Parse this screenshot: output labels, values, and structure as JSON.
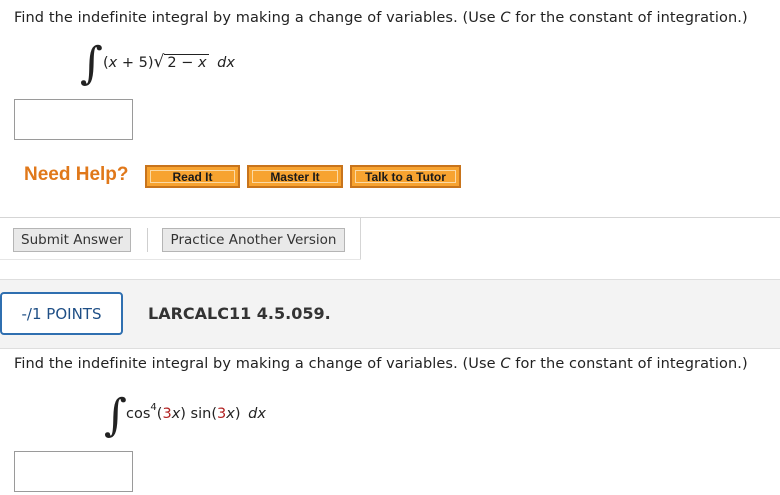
{
  "q1": {
    "prompt": "Find the indefinite integral by making a change of variables. (Use C for the constant of integration.)",
    "prompt_parts": [
      "Find the indefinite integral by making a change of variables. (Use ",
      "C",
      " for the constant of integration.)"
    ],
    "integrand": {
      "integral_sign": "∫",
      "open_paren": "(",
      "var_x": "x",
      "plus_five": " + 5)",
      "radical": "√",
      "radicand_num": "2",
      "minus": " − ",
      "radicand_var": "x",
      "dx": "dx"
    },
    "answer_value": ""
  },
  "help": {
    "label": "Need Help?",
    "buttons": [
      "Read It",
      "Master It",
      "Talk to a Tutor"
    ]
  },
  "actions": {
    "submit_label": "Submit Answer",
    "practice_label": "Practice Another Version"
  },
  "q2_header": {
    "points": "-/1 POINTS",
    "problem_id": "LARCALC11 4.5.059."
  },
  "q2": {
    "prompt_parts": [
      "Find the indefinite integral by making a change of variables. (Use ",
      "C",
      " for the constant of integration.)"
    ],
    "integrand": {
      "integral_sign": "∫",
      "cos": "cos",
      "exponent": "4",
      "arg1_open": "(",
      "arg1_num": "3",
      "arg1_var": "x",
      "arg1_close": ")",
      "sin": " sin(",
      "arg2_num": "3",
      "arg2_var": "x",
      "arg2_close": ")",
      "dx": "dx"
    },
    "answer_value": ""
  },
  "colors": {
    "need_help": "#e0781a",
    "help_button": "#f7a330",
    "points_border": "#2f6fb0",
    "highlight_red": "#b22222"
  }
}
